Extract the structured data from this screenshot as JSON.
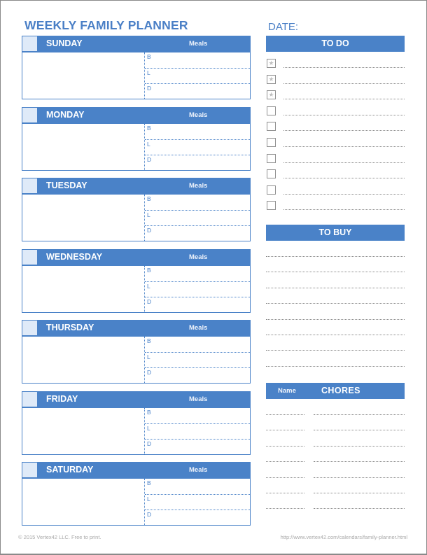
{
  "header": {
    "title": "WEEKLY FAMILY PLANNER",
    "date_label": "DATE:"
  },
  "days": [
    {
      "name": "SUNDAY",
      "meals_label": "Meals",
      "meals": [
        "B",
        "L",
        "D"
      ]
    },
    {
      "name": "MONDAY",
      "meals_label": "Meals",
      "meals": [
        "B",
        "L",
        "D"
      ]
    },
    {
      "name": "TUESDAY",
      "meals_label": "Meals",
      "meals": [
        "B",
        "L",
        "D"
      ]
    },
    {
      "name": "WEDNESDAY",
      "meals_label": "Meals",
      "meals": [
        "B",
        "L",
        "D"
      ]
    },
    {
      "name": "THURSDAY",
      "meals_label": "Meals",
      "meals": [
        "B",
        "L",
        "D"
      ]
    },
    {
      "name": "FRIDAY",
      "meals_label": "Meals",
      "meals": [
        "B",
        "L",
        "D"
      ]
    },
    {
      "name": "SATURDAY",
      "meals_label": "Meals",
      "meals": [
        "B",
        "L",
        "D"
      ]
    }
  ],
  "todo": {
    "title": "TO DO",
    "items": [
      {
        "starred": true
      },
      {
        "starred": true
      },
      {
        "starred": true
      },
      {
        "starred": false
      },
      {
        "starred": false
      },
      {
        "starred": false
      },
      {
        "starred": false
      },
      {
        "starred": false
      },
      {
        "starred": false
      },
      {
        "starred": false
      }
    ],
    "star_glyph": "★"
  },
  "tobuy": {
    "title": "TO BUY",
    "line_count": 8
  },
  "chores": {
    "name_label": "Name",
    "title": "CHORES",
    "row_count": 7
  },
  "footer": {
    "copyright": "© 2015 Vertex42 LLC. Free to print.",
    "url": "http://www.vertex42.com/calendars/family-planner.html"
  },
  "colors": {
    "accent": "#4a82c8",
    "title": "#4a7fc6",
    "check_fill": "#dfeaf8"
  }
}
